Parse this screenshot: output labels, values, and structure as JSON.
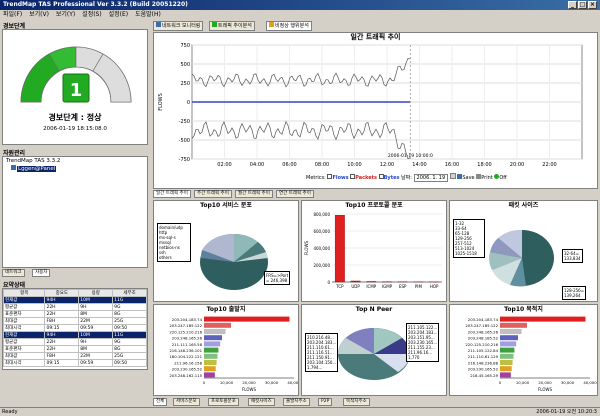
{
  "window": {
    "title": "TrendMap TAS Professional Ver 3.3.2 (Build 20051220)"
  },
  "menu": [
    "파일(F)",
    "보기(V)",
    "보기(Y)",
    "설정(S)",
    "설정(E)",
    "도움말(H)"
  ],
  "left": {
    "alert_section": "경보단계",
    "gauge_value": "1",
    "alert_status": "경보단계 : 정상",
    "alert_time": "2006-01-19 18:15:08.0",
    "asset_section": "자원관리",
    "tree_root": "TrendMap TAS 3.3.2",
    "tree_child": "Lggen@Panel",
    "tabs": [
      "네트워크",
      "사용자"
    ],
    "status_section": "요약상태",
    "table_headers": [
      "항목",
      "중요도",
      "용량",
      "세부조"
    ],
    "rows": [
      {
        "c": [
          "현재값",
          "94H",
          "10M",
          "11G"
        ],
        "sel": true
      },
      {
        "c": [
          "평균값",
          "22H",
          "9H",
          "9G"
        ],
        "sel": false
      },
      {
        "c": [
          "표준편차",
          "22H",
          "8M",
          "8G"
        ],
        "sel": false
      },
      {
        "c": [
          "최대값",
          "F8H",
          "22M",
          "25G"
        ],
        "sel": false
      },
      {
        "c": [
          "최대시각",
          "09:15",
          "09:59",
          "09:50"
        ],
        "sel": false
      },
      {
        "c": [
          "현재값",
          "94H",
          "10M",
          "11G"
        ],
        "sel": true
      },
      {
        "c": [
          "평균값",
          "22H",
          "9H",
          "9G"
        ],
        "sel": false
      },
      {
        "c": [
          "표준편차",
          "22H",
          "8M",
          "8G"
        ],
        "sel": false
      },
      {
        "c": [
          "최대값",
          "F8H",
          "22M",
          "25G"
        ],
        "sel": false
      },
      {
        "c": [
          "최대시각",
          "09:15",
          "09:59",
          "09:50"
        ],
        "sel": false
      }
    ]
  },
  "top_tabs": [
    "네트워크 모니터링",
    "트래픽 추이분석",
    "비정상 행위분석"
  ],
  "trend": {
    "title": "일간 트래픽 추이",
    "y_ticks": [
      "750",
      "500",
      "250",
      "0",
      "-250",
      "-500",
      "-750"
    ],
    "x_ticks": [
      "02:00",
      "04:00",
      "06:00",
      "08:00",
      "10:00",
      "12:00",
      "14:00",
      "16:00",
      "18:00",
      "20:00",
      "22:00"
    ],
    "ylabel": "FLOWS",
    "timestamp": "2006-01-19 10:00:0",
    "metrics_label": "Metrics:",
    "m_flows": "Flows",
    "m_packets": "Packets",
    "m_bytes": "Bytes",
    "date_label": "날짜:",
    "date_value": "2006. 1. 19",
    "save": "Save",
    "print": "Print",
    "off": "Off"
  },
  "mid_tabs": [
    "일간 트래픽 추이",
    "주간 트래픽 추이",
    "월간 트래픽 추이",
    "연간 트래픽 추이"
  ],
  "panels": {
    "svc": {
      "title": "Top10 서비스 분포",
      "legend": [
        "domain/udp",
        "http",
        "ms-sql-s",
        "mssql",
        "netbios-ns",
        "ssh",
        "others"
      ],
      "label": "FRS=>Port\n= 246,398"
    },
    "proto": {
      "title": "Top10 프로토콜 분포",
      "y_ticks": [
        "800,000",
        "600,000",
        "400,000",
        "200,000",
        "0"
      ],
      "cats": [
        "TCP",
        "UDP",
        "ICMP",
        "IGMP",
        "ESP",
        "PIM",
        "HOP"
      ],
      "values": [
        785000,
        12000,
        6000,
        3000,
        2000,
        1000,
        1000
      ],
      "ylabel": "FLOWS"
    },
    "pkt": {
      "title": "패킷 사이즈",
      "legend": [
        "1-32",
        "33-64",
        "65-128",
        "129-256",
        "257-512",
        "513-1024",
        "1025-1518"
      ],
      "label1": "32-64=\n133,834",
      "label2": "128-256=\n139,264"
    },
    "src": {
      "title": "Top10 출발지",
      "ips": [
        "203.204.183.74",
        "203.247.185.122",
        "220.125.210.216",
        "203.248.165.26",
        "211.111.165.58",
        "216.148.236.101",
        "180.104.222.121",
        "211.96.16.158",
        "203.230.165.52",
        "203.248.162.115"
      ],
      "x_ticks": [
        "0",
        "10,000",
        "20,000",
        "30,000",
        "40,000"
      ],
      "xlabel": "FLOWS"
    },
    "p2p": {
      "title": "Top N Peer",
      "left_ips": [
        "210.216.48...",
        "203.204.183...",
        "211.110.61...",
        "211.116.51...",
        "211.150.91...",
        "203.104.150...",
        "1,794..."
      ],
      "right_ips": [
        "211.105.122...",
        "203.204.183...",
        "203.151.95...",
        "203.230.165...",
        "211.155.23...",
        "211.96.16...",
        "1,770"
      ]
    },
    "dst": {
      "title": "Top10 목적지",
      "ips": [
        "203.204.183.74",
        "203.247.185.122",
        "203.248.165.26",
        "203.248.185.52",
        "220.125.210.216",
        "211.105.122.84",
        "211.110.61.129",
        "216.148.236.88",
        "203.230.165.52",
        "218.45.165.29"
      ],
      "x_ticks": [
        "0",
        "10,000",
        "20,000",
        "30,000",
        "40,000"
      ],
      "xlabel": "FLOWS"
    }
  },
  "bottom_tabs": [
    "전체",
    "서비스분포",
    "프로토콜분포",
    "패킷사이즈",
    "출발지주소",
    "P2P",
    "목적지주소"
  ],
  "status": {
    "left": "Ready",
    "right": "2006-01-19 오전 10:20:3"
  },
  "colors": {
    "accent": "#0a246a",
    "gauge_green": "#22aa22",
    "bar_red": "#e02020"
  }
}
